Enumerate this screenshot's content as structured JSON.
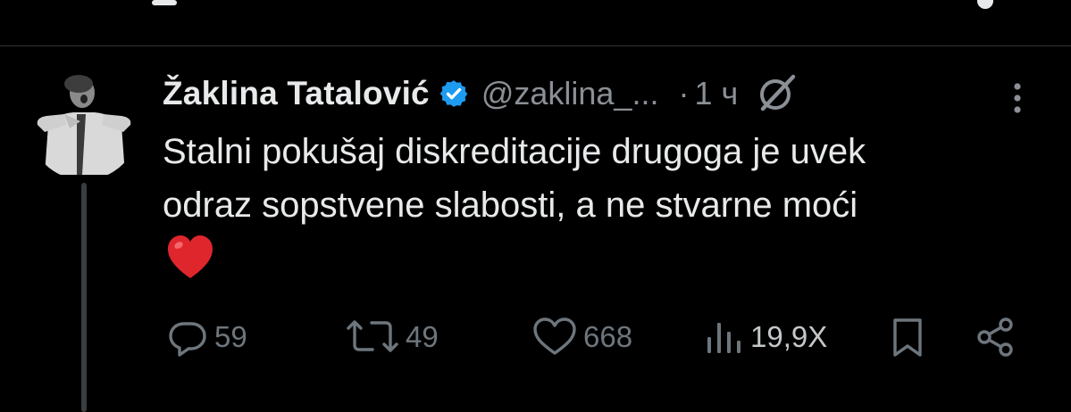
{
  "post": {
    "display_name": "Žaklina Tatalović",
    "handle": "@zaklina_...",
    "separator": "·",
    "time": "1 ч",
    "text_lines": [
      "Stalni pokušaj diskreditacije drugoga je uvek",
      "odraz sopstvene slabosti, a ne stvarne moći"
    ],
    "emoji": "red-heart",
    "verified": true
  },
  "actions": {
    "replies": "59",
    "reposts": "49",
    "likes": "668",
    "views": "19,9X"
  },
  "colors": {
    "background": "#000000",
    "text": "#e7e9ea",
    "secondary": "#8b9096",
    "verified_blue": "#1d9bf0",
    "heart_red": "#e0262d"
  },
  "icons": [
    "verified-badge-icon",
    "grok-icon",
    "more-options-icon",
    "reply-icon",
    "repost-icon",
    "like-icon",
    "views-icon",
    "bookmark-icon",
    "share-icon"
  ]
}
